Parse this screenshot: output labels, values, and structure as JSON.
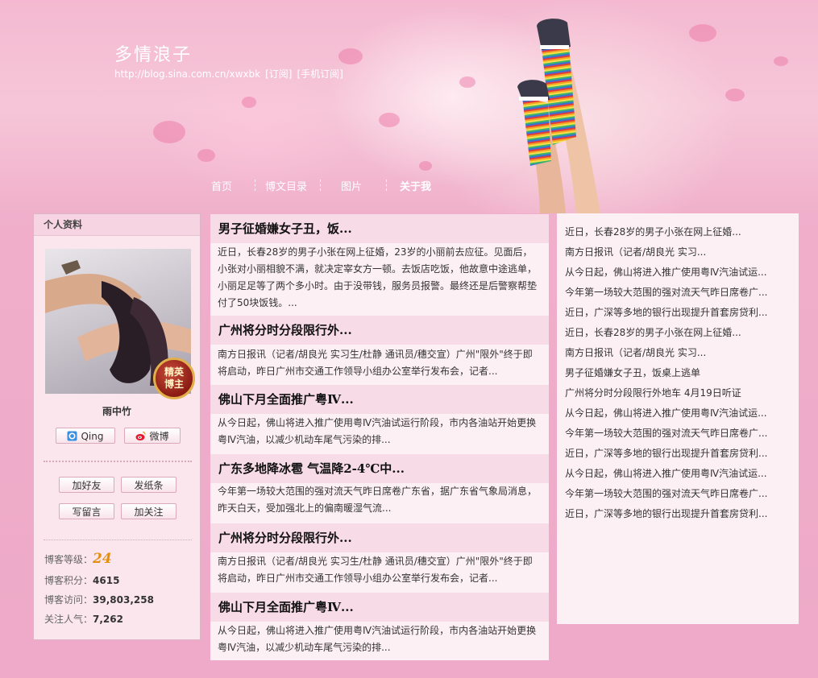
{
  "header": {
    "blog_title": "多情浪子",
    "url": "http://blog.sina.com.cn/xwxbk",
    "subscribe": "[订阅]",
    "mobile_subscribe": "[手机订阅]"
  },
  "nav": [
    {
      "label": "首页"
    },
    {
      "label": "博文目录"
    },
    {
      "label": "图片"
    },
    {
      "label": "关于我"
    }
  ],
  "profile": {
    "heading": "个人资料",
    "badge_line1": "精英",
    "badge_line2": "博主",
    "username": "雨中竹",
    "qing_label": "Qing",
    "weibo_label": "微博",
    "add_friend": "加好友",
    "send_note": "发纸条",
    "leave_message": "写留言",
    "follow": "加关注",
    "level_label": "博客等级：",
    "level_value": "24",
    "points_label": "博客积分：",
    "points_value": "4615",
    "visits_label": "博客访问：",
    "visits_value": "39,803,258",
    "popularity_label": "关注人气：",
    "popularity_value": "7,262"
  },
  "articles": [
    {
      "title": "男子征婚嫌女子丑，饭...",
      "lines": [
        "近日，长春28岁的男子小张在网上征婚，23岁的小丽前去应征。见面后，",
        "小张对小丽相貌不满，就决定宰女方一顿。去饭店吃饭，他故意中途逃单，",
        "小丽足足等了两个多小时。由于没带钱，服务员报警。最终还是后警察帮垫",
        "付了50块饭钱。..."
      ]
    },
    {
      "title": "广州将分时分段限行外...",
      "lines": [
        "南方日报讯（记者/胡良光 实习生/杜静 通讯员/穗交宣）广州\"限外\"终于即",
        "将启动，昨日广州市交通工作领导小组办公室举行发布会，记者..."
      ]
    },
    {
      "title": "佛山下月全面推广粤Ⅳ...",
      "lines": [
        "从今日起，佛山将进入推广使用粤Ⅳ汽油试运行阶段，市内各油站开始更换",
        "粤Ⅳ汽油，以减少机动车尾气污染的排..."
      ]
    },
    {
      "title": "广东多地降冰雹 气温降2-4℃中...",
      "lines": [
        "今年第一场较大范围的强对流天气昨日席卷广东省，据广东省气象局消息，",
        "昨天白天，受加强北上的偏南暖湿气流..."
      ]
    },
    {
      "title": "广州将分时分段限行外...",
      "lines": [
        "南方日报讯（记者/胡良光 实习生/杜静 通讯员/穗交宣）广州\"限外\"终于即",
        "将启动，昨日广州市交通工作领导小组办公室举行发布会，记者..."
      ]
    },
    {
      "title": "佛山下月全面推广粤Ⅳ...",
      "lines": [
        "从今日起，佛山将进入推广使用粤Ⅳ汽油试运行阶段，市内各油站开始更换",
        "粤Ⅳ汽油，以减少机动车尾气污染的排..."
      ]
    }
  ],
  "side_list": [
    "近日，长春28岁的男子小张在网上征婚...",
    "南方日报讯（记者/胡良光 实习...",
    "从今日起，佛山将进入推广使用粤Ⅳ汽油试运...",
    "今年第一场较大范围的强对流天气昨日席卷广...",
    "近日，广深等多地的银行出现提升首套房贷利...",
    "近日，长春28岁的男子小张在网上征婚...",
    "南方日报讯（记者/胡良光 实习...",
    "男子征婚嫌女子丑，饭桌上逃单",
    "广州将分时分段限行外地车 4月19日听证",
    "从今日起，佛山将进入推广使用粤Ⅳ汽油试运...",
    "今年第一场较大范围的强对流天气昨日席卷广...",
    "近日，广深等多地的银行出现提升首套房贷利...",
    "从今日起，佛山将进入推广使用粤Ⅳ汽油试运...",
    "今年第一场较大范围的强对流天气昨日席卷广...",
    "近日，广深等多地的银行出现提升首套房贷利..."
  ]
}
